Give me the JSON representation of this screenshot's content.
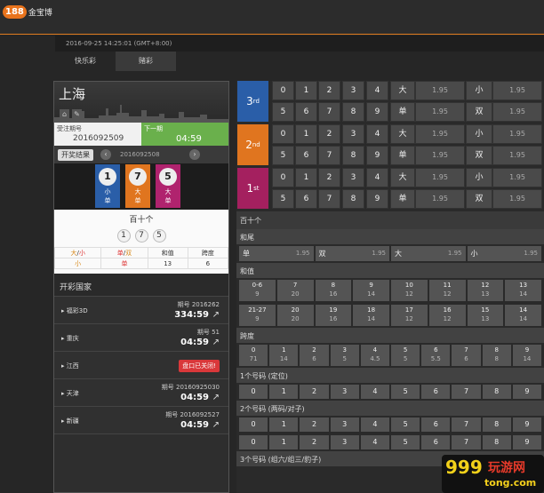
{
  "header": {
    "logo_num": "188",
    "logo_text": "金宝博"
  },
  "subbar": {
    "datetime": "2016-09-25 14:25:01 (GMT+8:00)"
  },
  "tabs": [
    {
      "label": "快乐彩"
    },
    {
      "label": "赌彩"
    }
  ],
  "left": {
    "city": "上海",
    "current": {
      "label": "受注期号",
      "number": "2016092509"
    },
    "next": {
      "label": "下一期",
      "time": "04:59"
    },
    "results_button": "开奖结果",
    "result_number": "2016092508",
    "balls": [
      {
        "n": "1",
        "a": "小",
        "b": "单",
        "color": "#2a5ea8"
      },
      {
        "n": "7",
        "a": "大",
        "b": "单",
        "color": "#e0751f"
      },
      {
        "n": "5",
        "a": "大",
        "b": "单",
        "color": "#b0236e"
      }
    ],
    "summary": {
      "title": "百十个",
      "balls": [
        "1",
        "7",
        "5"
      ],
      "headers": [
        "大/小",
        "单/双",
        "和值",
        "跨度"
      ],
      "values": [
        "小",
        "单",
        "13",
        "6"
      ]
    },
    "plist_title": "开彩国家",
    "plist": [
      {
        "name": "福彩3D",
        "period": "期号 2016262",
        "time": "334:59",
        "closed": ""
      },
      {
        "name": "重庆",
        "period": "期号 51",
        "time": "04:59",
        "closed": ""
      },
      {
        "name": "江西",
        "period": "",
        "time": "",
        "closed": "盘口已关闭!"
      },
      {
        "name": "天津",
        "period": "期号 20160925030",
        "time": "04:59",
        "closed": ""
      },
      {
        "name": "新疆",
        "period": "期号 2016092527",
        "time": "04:59",
        "closed": ""
      }
    ]
  },
  "positions": [
    {
      "rank": "3",
      "suffix": "rd",
      "color": "#2a5ea8",
      "row1": [
        "0",
        "1",
        "2",
        "3",
        "4"
      ],
      "row2": [
        "5",
        "6",
        "7",
        "8",
        "9"
      ],
      "opts": [
        [
          "大",
          "1.95",
          "小",
          "1.95"
        ],
        [
          "单",
          "1.95",
          "双",
          "1.95"
        ]
      ]
    },
    {
      "rank": "2",
      "suffix": "nd",
      "color": "#e0751f",
      "row1": [
        "0",
        "1",
        "2",
        "3",
        "4"
      ],
      "row2": [
        "5",
        "6",
        "7",
        "8",
        "9"
      ],
      "opts": [
        [
          "大",
          "1.95",
          "小",
          "1.95"
        ],
        [
          "单",
          "1.95",
          "双",
          "1.95"
        ]
      ]
    },
    {
      "rank": "1",
      "suffix": "st",
      "color": "#a4205f",
      "row1": [
        "0",
        "1",
        "2",
        "3",
        "4"
      ],
      "row2": [
        "5",
        "6",
        "7",
        "8",
        "9"
      ],
      "opts": [
        [
          "大",
          "1.95",
          "小",
          "1.95"
        ],
        [
          "单",
          "1.95",
          "双",
          "1.95"
        ]
      ]
    }
  ],
  "sections": {
    "main": "百十个",
    "hezhi_big": "和尾",
    "bigsmall": [
      [
        "单",
        "1.95"
      ],
      [
        "双",
        "1.95"
      ],
      [
        "大",
        "1.95"
      ],
      [
        "小",
        "1.95"
      ]
    ],
    "hezhi": "和值",
    "hz_row1": [
      [
        "0-6",
        "9"
      ],
      [
        "7",
        "20"
      ],
      [
        "8",
        "16"
      ],
      [
        "9",
        "14"
      ],
      [
        "10",
        "12"
      ],
      [
        "11",
        "12"
      ],
      [
        "12",
        "13"
      ],
      [
        "13",
        "14"
      ]
    ],
    "hz_row2": [
      [
        "21-27",
        "9"
      ],
      [
        "20",
        "20"
      ],
      [
        "19",
        "16"
      ],
      [
        "18",
        "14"
      ],
      [
        "17",
        "12"
      ],
      [
        "16",
        "12"
      ],
      [
        "15",
        "13"
      ],
      [
        "14",
        "14"
      ]
    ],
    "kuadu": "跨度",
    "kd_row": [
      [
        "0",
        "71"
      ],
      [
        "1",
        "14"
      ],
      [
        "2",
        "6"
      ],
      [
        "3",
        "5"
      ],
      [
        "4",
        "4.5"
      ],
      [
        "5",
        "5"
      ],
      [
        "6",
        "5.5"
      ],
      [
        "7",
        "6"
      ],
      [
        "8",
        "8"
      ],
      [
        "9",
        "14"
      ]
    ],
    "one": "1个号码 (定位)",
    "one_row": [
      "0",
      "1",
      "2",
      "3",
      "4",
      "5",
      "6",
      "7",
      "8",
      "9"
    ],
    "two": "2个号码 (两码/对子)",
    "two_row1": [
      "0",
      "1",
      "2",
      "3",
      "4",
      "5",
      "6",
      "7",
      "8",
      "9"
    ],
    "two_row2": [
      "0",
      "1",
      "2",
      "3",
      "4",
      "5",
      "6",
      "7",
      "8",
      "9"
    ],
    "three": "3个号码 (组六/组三/豹子)"
  },
  "watermark": {
    "num": "999",
    "cn": "玩游网",
    "domain": "tong.com"
  }
}
